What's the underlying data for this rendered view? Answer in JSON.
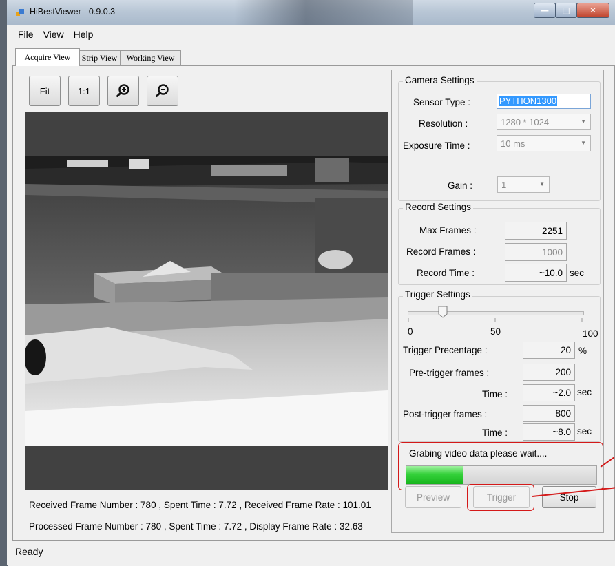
{
  "window": {
    "title": "HiBestViewer - 0.9.0.3",
    "minimize": "—",
    "maximize": "□",
    "close": "✕"
  },
  "menu": [
    "File",
    "View",
    "Help"
  ],
  "tabs": [
    {
      "label": "Acquire View",
      "active": true
    },
    {
      "label": "Strip View",
      "active": false
    },
    {
      "label": "Working View",
      "active": false
    }
  ],
  "toolbar": {
    "fit": "Fit",
    "one_to_one": "1:1",
    "zoom_in_icon": "zoom-in-icon",
    "zoom_out_icon": "zoom-out-icon"
  },
  "stats": {
    "received": "Received Frame Number : 780 , Spent Time : 7.72 , Received Frame Rate : 101.01",
    "processed": "Processed Frame Number : 780 , Spent Time : 7.72 ,  Display Frame Rate : 32.63"
  },
  "camera_settings": {
    "title": "Camera Settings",
    "sensor_type_label": "Sensor Type :",
    "sensor_type_value": "PYTHON1300",
    "resolution_label": "Resolution :",
    "resolution_value": "1280 * 1024",
    "exposure_label": "Exposure Time :",
    "exposure_value": "10 ms",
    "gain_label": "Gain :",
    "gain_value": "1"
  },
  "record_settings": {
    "title": "Record Settings",
    "max_frames_label": "Max Frames :",
    "max_frames_value": "2251",
    "record_frames_label": "Record Frames :",
    "record_frames_value": "1000",
    "record_time_label": "Record Time :",
    "record_time_value": "~10.0",
    "record_time_unit": "sec"
  },
  "trigger_settings": {
    "title": "Trigger Settings",
    "slider_value": 20,
    "scale_min": "0",
    "scale_mid": "50",
    "scale_max": "100",
    "percentage_label": "Trigger Precentage :",
    "percentage_value": "20",
    "percentage_unit": "%",
    "pre_frames_label": "Pre-trigger frames :",
    "pre_frames_value": "200",
    "pre_time_label": "Time :",
    "pre_time_value": "~2.0",
    "pre_time_unit": "sec",
    "post_frames_label": "Post-trigger frames :",
    "post_frames_value": "800",
    "post_time_label": "Time :",
    "post_time_value": "~8.0",
    "post_time_unit": "sec"
  },
  "grab": {
    "message": "Grabing video data please wait....",
    "progress": 0.3
  },
  "buttons": {
    "preview": "Preview",
    "trigger": "Trigger",
    "stop": "Stop"
  },
  "status": "Ready",
  "colors": {
    "progress_green": "#22c02a",
    "annotation_red": "#d41919",
    "selection_blue": "#3399ff"
  }
}
